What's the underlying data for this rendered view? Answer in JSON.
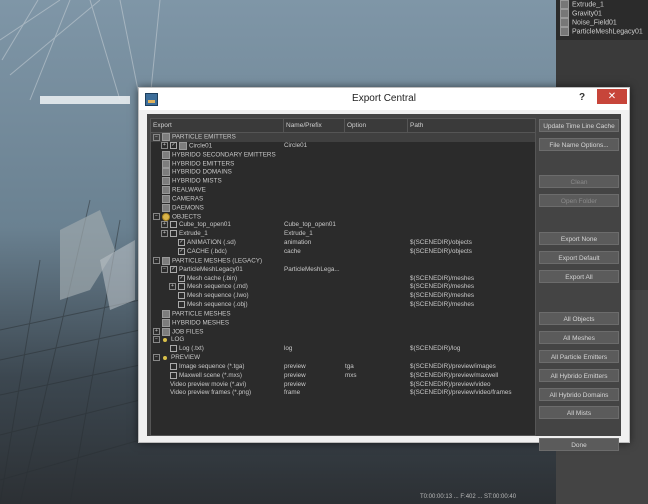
{
  "dialog": {
    "title": "Export Central",
    "help_label": "?",
    "close_label": "✕",
    "columns": [
      "Export",
      "Name/Prefix",
      "Option",
      "Path"
    ]
  },
  "outliner": {
    "items": [
      "Extrude_1",
      "Gravity01",
      "Noise_Field01",
      "ParticleMeshLegacy01"
    ]
  },
  "timebar": {
    "text": "T0:00:00:13 ... F:402 ... ST:00:00:40"
  },
  "tree": [
    {
      "label": "PARTICLE EMITTERS",
      "indent": 0,
      "exp": "-",
      "chk": null,
      "icon": "group",
      "name": "",
      "option": "",
      "path": ""
    },
    {
      "label": "Circle01",
      "indent": 1,
      "exp": "+",
      "chk": true,
      "icon": "item",
      "name": "Circle01",
      "option": "",
      "path": ""
    },
    {
      "label": "HYBRIDO SECONDARY EMITTERS",
      "indent": 0,
      "exp": "",
      "chk": null,
      "icon": "group",
      "name": "",
      "option": "",
      "path": ""
    },
    {
      "label": "HYBRIDO EMITTERS",
      "indent": 0,
      "exp": "",
      "chk": null,
      "icon": "group",
      "name": "",
      "option": "",
      "path": ""
    },
    {
      "label": "HYBRIDO DOMAINS",
      "indent": 0,
      "exp": "",
      "chk": null,
      "icon": "group",
      "name": "",
      "option": "",
      "path": ""
    },
    {
      "label": "HYBRIDO MISTS",
      "indent": 0,
      "exp": "",
      "chk": null,
      "icon": "group",
      "name": "",
      "option": "",
      "path": ""
    },
    {
      "label": "REALWAVE",
      "indent": 0,
      "exp": "",
      "chk": null,
      "icon": "group",
      "name": "",
      "option": "",
      "path": ""
    },
    {
      "label": "CAMERAS",
      "indent": 0,
      "exp": "",
      "chk": null,
      "icon": "group",
      "name": "",
      "option": "",
      "path": ""
    },
    {
      "label": "DAEMONS",
      "indent": 0,
      "exp": "",
      "chk": null,
      "icon": "group",
      "name": "",
      "option": "",
      "path": ""
    },
    {
      "label": "OBJECTS",
      "indent": 0,
      "exp": "-",
      "chk": null,
      "icon": "yellow",
      "name": "",
      "option": "",
      "path": ""
    },
    {
      "label": "Cube_top_open01",
      "indent": 1,
      "exp": "+",
      "chk": false,
      "icon": null,
      "name": "Cube_top_open01",
      "option": "",
      "path": ""
    },
    {
      "label": "Extrude_1",
      "indent": 1,
      "exp": "+",
      "chk": false,
      "icon": null,
      "name": "Extrude_1",
      "option": "",
      "path": ""
    },
    {
      "label": "ANIMATION (.sd)",
      "indent": 2,
      "exp": "",
      "chk": true,
      "icon": null,
      "name": "animation",
      "option": "",
      "path": "$(SCENEDIR)/objects"
    },
    {
      "label": "CACHE (.bdc)",
      "indent": 2,
      "exp": "",
      "chk": true,
      "icon": null,
      "name": "cache",
      "option": "",
      "path": "$(SCENEDIR)/objects"
    },
    {
      "label": "PARTICLE MESHES (LEGACY)",
      "indent": 0,
      "exp": "-",
      "chk": null,
      "icon": "group",
      "name": "",
      "option": "",
      "path": ""
    },
    {
      "label": "ParticleMeshLegacy01",
      "indent": 1,
      "exp": "-",
      "chk": true,
      "icon": null,
      "name": "ParticleMeshLega...",
      "option": "",
      "path": ""
    },
    {
      "label": "Mesh cache (.bin)",
      "indent": 2,
      "exp": "",
      "chk": true,
      "icon": null,
      "name": "",
      "option": "",
      "path": "$(SCENEDIR)/meshes"
    },
    {
      "label": "Mesh sequence (.md)",
      "indent": 2,
      "exp": "+",
      "chk": false,
      "icon": null,
      "name": "",
      "option": "",
      "path": "$(SCENEDIR)/meshes"
    },
    {
      "label": "Mesh sequence (.lwo)",
      "indent": 2,
      "exp": "",
      "chk": false,
      "icon": null,
      "name": "",
      "option": "",
      "path": "$(SCENEDIR)/meshes"
    },
    {
      "label": "Mesh sequence (.obj)",
      "indent": 2,
      "exp": "",
      "chk": false,
      "icon": null,
      "name": "",
      "option": "",
      "path": "$(SCENEDIR)/meshes"
    },
    {
      "label": "PARTICLE MESHES",
      "indent": 0,
      "exp": "",
      "chk": null,
      "icon": "group",
      "name": "",
      "option": "",
      "path": ""
    },
    {
      "label": "HYBRIDO MESHES",
      "indent": 0,
      "exp": "",
      "chk": null,
      "icon": "group",
      "name": "",
      "option": "",
      "path": ""
    },
    {
      "label": "JOB FILES",
      "indent": 0,
      "exp": "+",
      "chk": null,
      "icon": "group",
      "name": "",
      "option": "",
      "path": ""
    },
    {
      "label": "LOG",
      "indent": 0,
      "exp": "-",
      "chk": null,
      "icon": "bullet",
      "name": "",
      "option": "",
      "path": ""
    },
    {
      "label": "Log (.txt)",
      "indent": 1,
      "exp": "",
      "chk": false,
      "icon": null,
      "name": "log",
      "option": "",
      "path": "$(SCENEDIR)/log"
    },
    {
      "label": "PREVIEW",
      "indent": 0,
      "exp": "-",
      "chk": null,
      "icon": "bullet",
      "name": "",
      "option": "",
      "path": ""
    },
    {
      "label": "Image sequence (*.tga)",
      "indent": 1,
      "exp": "",
      "chk": false,
      "icon": null,
      "name": "preview",
      "option": "tga",
      "path": "$(SCENEDIR)/preview/images"
    },
    {
      "label": "Maxwell scene (*.mxs)",
      "indent": 1,
      "exp": "",
      "chk": false,
      "icon": null,
      "name": "preview",
      "option": "mxs",
      "path": "$(SCENEDIR)/preview/maxwell"
    },
    {
      "label": "Video preview movie (*.avi)",
      "indent": 1,
      "exp": "",
      "chk": null,
      "icon": null,
      "name": "preview",
      "option": "",
      "path": "$(SCENEDIR)/preview/video"
    },
    {
      "label": "Video preview frames (*.png)",
      "indent": 1,
      "exp": "",
      "chk": null,
      "icon": null,
      "name": "frame",
      "option": "",
      "path": "$(SCENEDIR)/preview/video/frames"
    }
  ],
  "buttons": [
    {
      "label": "Update Time Line Cache",
      "disabled": false
    },
    {
      "label": "File Name Options...",
      "disabled": false
    },
    {
      "label": "Clean",
      "disabled": true
    },
    {
      "label": "Open Folder",
      "disabled": true
    },
    {
      "label": "Export None",
      "disabled": false
    },
    {
      "label": "Export Default",
      "disabled": false
    },
    {
      "label": "Export All",
      "disabled": false
    },
    {
      "label": "All Objects",
      "disabled": false
    },
    {
      "label": "All Meshes",
      "disabled": false
    },
    {
      "label": "All Particle Emitters",
      "disabled": false
    },
    {
      "label": "All Hybrido Emitters",
      "disabled": false
    },
    {
      "label": "All Hybrido Domains",
      "disabled": false
    },
    {
      "label": "All Mists",
      "disabled": false
    },
    {
      "label": "Done",
      "disabled": false
    }
  ]
}
